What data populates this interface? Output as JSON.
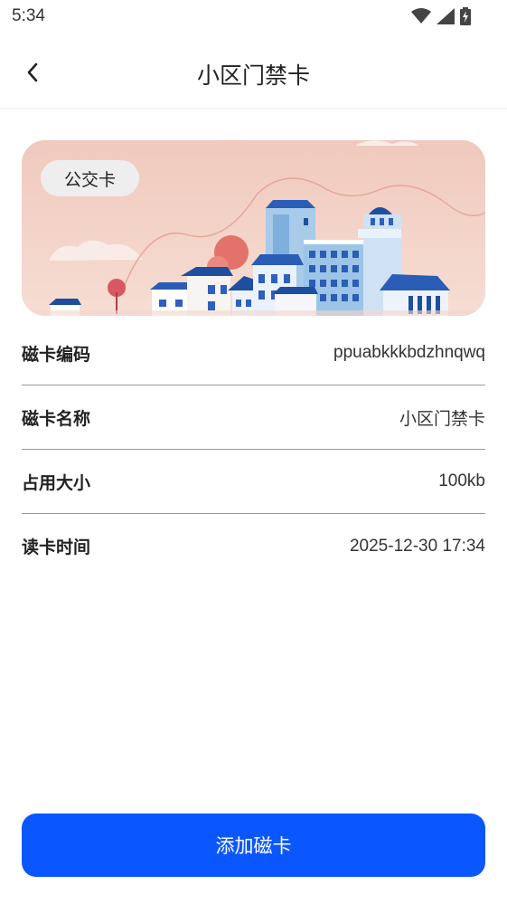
{
  "status_bar": {
    "time": "5:34",
    "icons": [
      "wifi-icon",
      "signal-icon",
      "battery-icon"
    ]
  },
  "nav": {
    "title": "小区门禁卡",
    "back_icon": "chevron-left-icon"
  },
  "card": {
    "tag": "公交卡",
    "illustration": "city-skyline-illustration"
  },
  "info": [
    {
      "label": "磁卡编码",
      "value": "ppuabkkkbdzhnqwq"
    },
    {
      "label": "磁卡名称",
      "value": "小区门禁卡"
    },
    {
      "label": "占用大小",
      "value": "100kb"
    },
    {
      "label": "读卡时间",
      "value": "2025-12-30 17:34"
    }
  ],
  "action": {
    "add_label": "添加磁卡"
  },
  "colors": {
    "primary": "#0a57ff",
    "card_bg": "#f3d2c7"
  }
}
